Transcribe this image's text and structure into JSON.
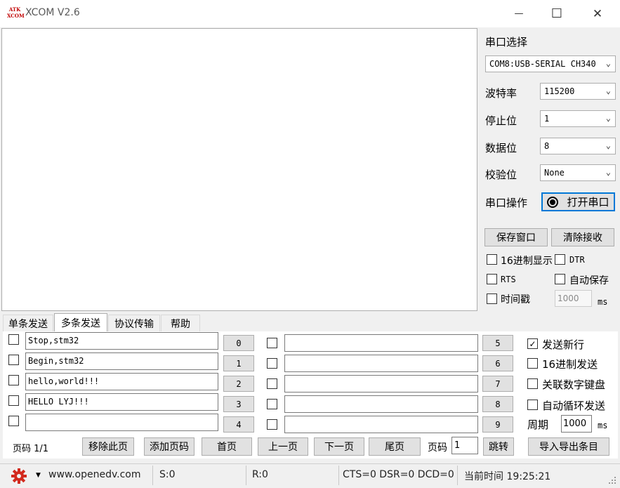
{
  "window": {
    "title": "XCOM V2.6",
    "logo_line1": "ATK",
    "logo_line2": "XCOM",
    "minimize_glyph": "—",
    "maximize_glyph": "☐",
    "close_glyph": "✕"
  },
  "serial": {
    "port_label": "串口选择",
    "port_value": "COM8:USB-SERIAL CH340",
    "baud_label": "波特率",
    "baud_value": "115200",
    "stop_label": "停止位",
    "stop_value": "1",
    "data_label": "数据位",
    "data_value": "8",
    "parity_label": "校验位",
    "parity_value": "None",
    "op_label": "串口操作",
    "open_button": "打开串口",
    "save_window": "保存窗口",
    "clear_recv": "清除接收",
    "hex_display": "16进制显示",
    "dtr": "DTR",
    "rts": "RTS",
    "auto_save": "自动保存",
    "timestamp": "时间戳",
    "timestamp_value": "1000",
    "timestamp_unit": "ms"
  },
  "tabs": [
    "单条发送",
    "多条发送",
    "协议传输",
    "帮助"
  ],
  "multi": {
    "left_rows": [
      {
        "text": "Stop,stm32",
        "button": "0"
      },
      {
        "text": "Begin,stm32",
        "button": "1"
      },
      {
        "text": "hello,world!!!",
        "button": "2"
      },
      {
        "text": "HELLO LYJ!!!",
        "button": "3"
      },
      {
        "text": "",
        "button": "4"
      }
    ],
    "right_rows": [
      {
        "text": "",
        "button": "5"
      },
      {
        "text": "",
        "button": "6"
      },
      {
        "text": "",
        "button": "7"
      },
      {
        "text": "",
        "button": "8"
      },
      {
        "text": "",
        "button": "9"
      }
    ],
    "send_newline": "发送新行",
    "hex_send": "16进制发送",
    "link_keypad": "关联数字键盘",
    "auto_loop": "自动循环发送",
    "period_label": "周期",
    "period_value": "1000",
    "period_unit": "ms",
    "page_info": "页码 1/1",
    "remove_page": "移除此页",
    "add_page": "添加页码",
    "first_page": "首页",
    "prev_page": "上一页",
    "next_page": "下一页",
    "last_page": "尾页",
    "page_label": "页码",
    "page_value": "1",
    "jump": "跳转",
    "import_export": "导入导出条目"
  },
  "status": {
    "url": "www.openedv.com",
    "sent": "S:0",
    "received": "R:0",
    "signals": "CTS=0 DSR=0 DCD=0",
    "time": "当前时间 19:25:21"
  },
  "icons": {
    "settings": "gear-icon",
    "dropdown": "chevron-down-icon",
    "radio": "radio-icon",
    "resize_grip": "resize-grip-icon"
  },
  "colors": {
    "accent_border": "#0078d7",
    "gear_red": "#d22a1e",
    "logo_red": "#c00000"
  }
}
